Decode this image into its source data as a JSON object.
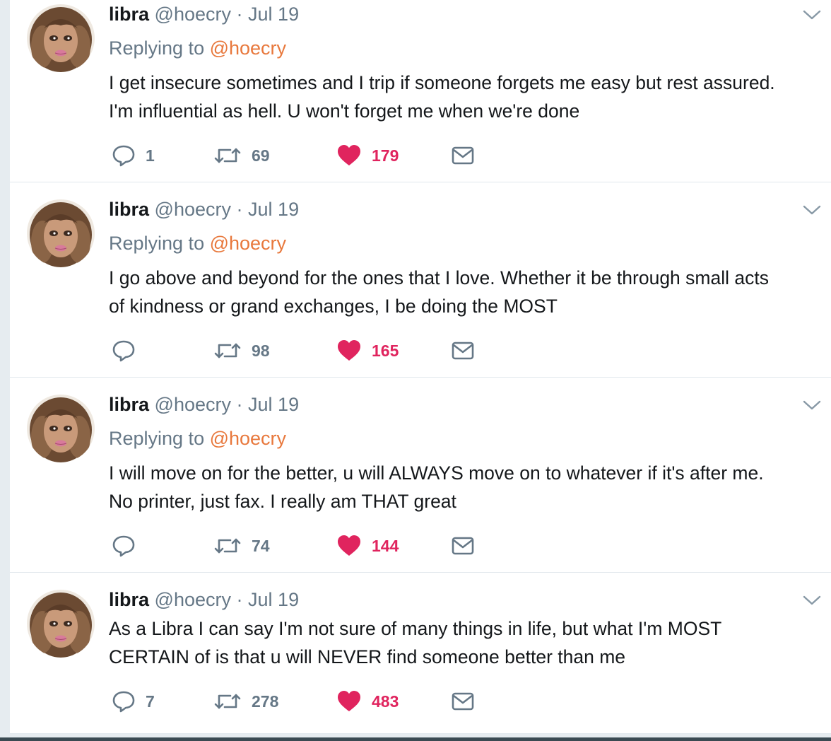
{
  "tweets": [
    {
      "name": "libra",
      "handle": "@hoecry",
      "separator": "·",
      "date": "Jul 19",
      "replying_prefix": "Replying to ",
      "replying_handle": "@hoecry",
      "lines": [
        "I get insecure sometimes and I trip if someone forgets me easy but rest assured.",
        "I'm influential as hell. U won't forget me when we're done"
      ],
      "reply_count": "1",
      "retweet_count": "69",
      "like_count": "179"
    },
    {
      "name": "libra",
      "handle": "@hoecry",
      "separator": "·",
      "date": "Jul 19",
      "replying_prefix": "Replying to ",
      "replying_handle": "@hoecry",
      "lines": [
        "I go above and beyond for the ones that I love. Whether it be through small acts",
        "of kindness or grand exchanges, I be doing the MOST"
      ],
      "reply_count": "",
      "retweet_count": "98",
      "like_count": "165"
    },
    {
      "name": "libra",
      "handle": "@hoecry",
      "separator": "·",
      "date": "Jul 19",
      "replying_prefix": "Replying to ",
      "replying_handle": "@hoecry",
      "lines": [
        "I will move on for the better, u will ALWAYS move on to whatever if it's after me.",
        "No printer, just fax. I really am THAT great"
      ],
      "reply_count": "",
      "retweet_count": "74",
      "like_count": "144"
    },
    {
      "name": "libra",
      "handle": "@hoecry",
      "separator": "·",
      "date": "Jul 19",
      "lines": [
        "As a Libra I can say I'm not sure of many things in life, but what I'm MOST",
        "CERTAIN of is that u will NEVER find someone better than me"
      ],
      "reply_count": "7",
      "retweet_count": "278",
      "like_count": "483"
    }
  ],
  "icons": {
    "reply": "speech-bubble-icon",
    "retweet": "retweet-arrows-icon",
    "like": "heart-icon",
    "dm": "envelope-icon",
    "menu": "chevron-down-icon"
  },
  "colors": {
    "mention": "#e8783c",
    "liked": "#e0245e",
    "muted": "#657786",
    "text": "#14171a",
    "divider": "#e1e8ed",
    "page_background": "#e6ecf0"
  }
}
